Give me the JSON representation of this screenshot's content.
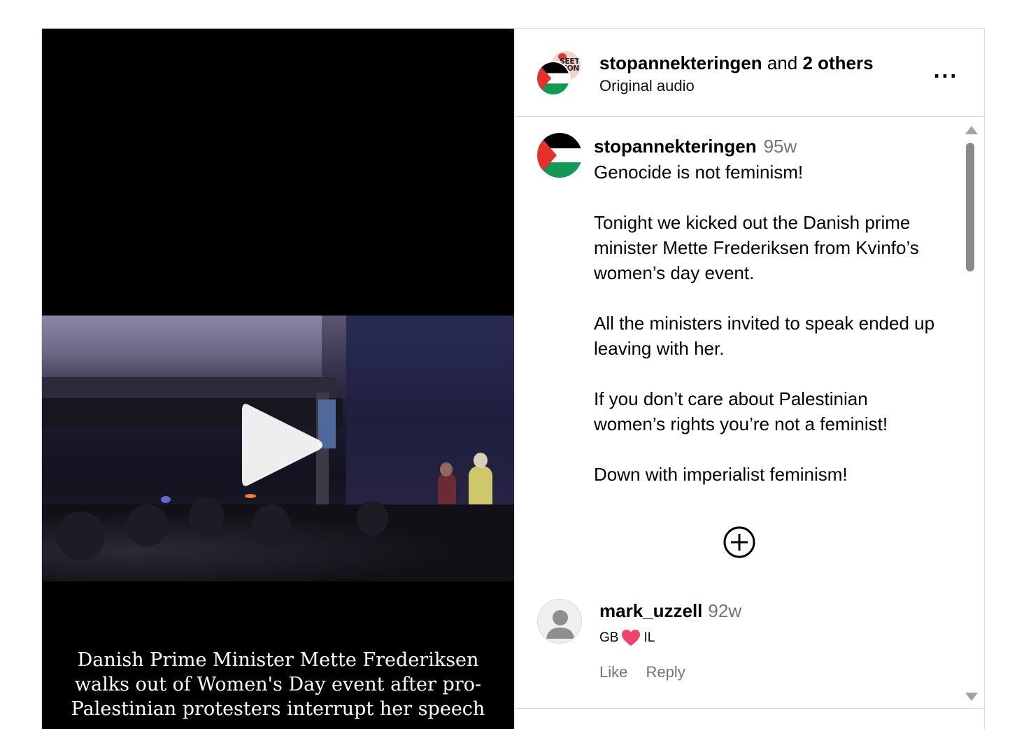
{
  "video": {
    "caption_lines": [
      "Danish Prime Minister Mette Frederiksen",
      "walks out of  Women's Day event after pro-",
      "Palestinian protesters interrupt her speech"
    ]
  },
  "header": {
    "username": "stopannekteringen",
    "and_text": "and",
    "others": "2 others",
    "subtitle": "Original audio",
    "more_label": "...",
    "collab_avatar_text": "SEET\nMON"
  },
  "post": {
    "username": "stopannekteringen",
    "time": "95w",
    "body": "Genocide is not feminism!\n\nTonight we kicked out the Danish prime minister Mette Frederiksen from Kvinfo’s women’s day event.\n\nAll the ministers invited to speak ended up leaving with her.\n\nIf you don’t care about Palestinian women’s rights you’re not a feminist!\n\nDown with imperialist feminism!"
  },
  "comment": {
    "username": "mark_uzzell",
    "time": "92w",
    "text_left": "GB",
    "text_right": "IL",
    "like_label": "Like",
    "reply_label": "Reply"
  },
  "colors": {
    "heart": "#f0446a",
    "flag_red": "#e4312b",
    "flag_green": "#149954",
    "muted": "#737373"
  }
}
